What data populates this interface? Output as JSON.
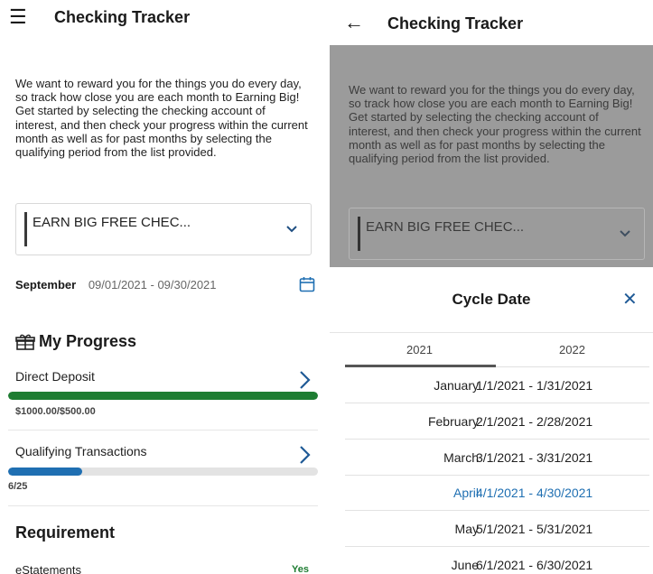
{
  "left": {
    "title": "Checking Tracker",
    "menu_icon": "hamburger-menu-icon",
    "intro": "We want to reward you for the things you do every day, so track how close you are each month to Earn­ing Big! Get started by selecting the checking account of interest, and then check your progress within the current month as well as for past months by selecting the qualifying period from the list provided.",
    "account_select": "EARN BIG FREE CHEC...",
    "period_month": "September",
    "period_range": "09/01/2021 - 09/30/2021",
    "progress_title": "My Progress",
    "progress": [
      {
        "label": "Direct Deposit",
        "value": "$1000.00/$500.00",
        "fraction": 1.0,
        "color": "#1e7d32"
      },
      {
        "label": "Qualifying Transactions",
        "value": "6/25",
        "fraction": 0.24,
        "color": "#1f6fb2"
      }
    ],
    "requirement_title": "Requirement",
    "requirements": [
      {
        "label": "eStatements",
        "value": "Yes"
      }
    ]
  },
  "right": {
    "title": "Checking Tracker",
    "back_icon": "back-arrow-icon",
    "intro": "We want to reward you for the things you do every day, so track how close you are each month to Earn­ing Big! Get started by selecting the checking account of interest, and then check your progress within the current month as well as for past months by selecting the qualifying period from the list provided.",
    "account_select": "EARN BIG FREE CHEC...",
    "sheet": {
      "title": "Cycle Date",
      "close": "✕",
      "tabs": [
        "2021",
        "2022"
      ],
      "selected_tab": "2021",
      "months": [
        {
          "name": "January",
          "range": "1/1/2021 - 1/31/2021"
        },
        {
          "name": "February",
          "range": "2/1/2021 - 2/28/2021"
        },
        {
          "name": "March",
          "range": "3/1/2021 - 3/31/2021"
        },
        {
          "name": "April",
          "range": "4/1/2021 - 4/30/2021",
          "active": true
        },
        {
          "name": "May",
          "range": "5/1/2021 - 5/31/2021"
        },
        {
          "name": "June",
          "range": "6/1/2021 - 6/30/2021"
        }
      ]
    }
  },
  "colors": {
    "accent_blue": "#1f6fb2",
    "success_green": "#1e7d32",
    "overlay_gray": "#9b9b9b"
  }
}
